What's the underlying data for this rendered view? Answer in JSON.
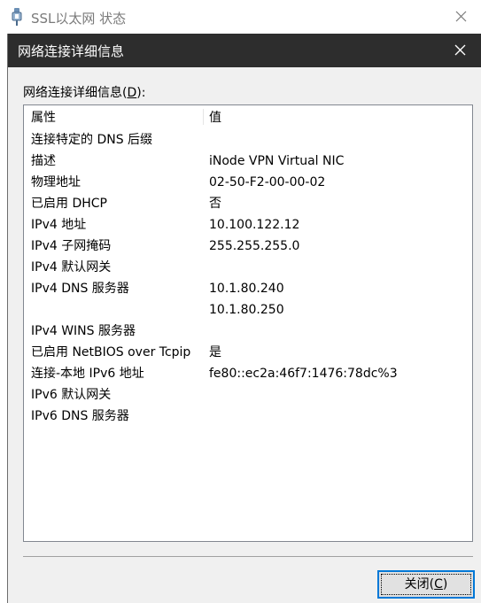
{
  "outer_window": {
    "title": "SSL以太网 状态",
    "app_icon": "network-connection-icon",
    "close_icon": "close-icon"
  },
  "dialog": {
    "title": "网络连接详细信息",
    "close_icon": "close-icon",
    "group_label": {
      "text": "网络连接详细信息(",
      "mnemonic": "D",
      "suffix": "):"
    },
    "columns": [
      "属性",
      "值"
    ],
    "rows": [
      {
        "prop": "连接特定的 DNS 后缀",
        "value": ""
      },
      {
        "prop": "描述",
        "value": "iNode VPN Virtual NIC"
      },
      {
        "prop": "物理地址",
        "value": "02-50-F2-00-00-02"
      },
      {
        "prop": "已启用 DHCP",
        "value": "否"
      },
      {
        "prop": "IPv4 地址",
        "value": "10.100.122.12"
      },
      {
        "prop": "IPv4 子网掩码",
        "value": "255.255.255.0"
      },
      {
        "prop": "IPv4 默认网关",
        "value": ""
      },
      {
        "prop": "IPv4 DNS 服务器",
        "value": "10.1.80.240"
      },
      {
        "prop": "",
        "value": "10.1.80.250"
      },
      {
        "prop": "IPv4 WINS 服务器",
        "value": ""
      },
      {
        "prop": "已启用 NetBIOS over Tcpip",
        "value": "是"
      },
      {
        "prop": "连接-本地 IPv6 地址",
        "value": "fe80::ec2a:46f7:1476:78dc%3"
      },
      {
        "prop": "IPv6 默认网关",
        "value": ""
      },
      {
        "prop": "IPv6 DNS 服务器",
        "value": ""
      }
    ],
    "close_button": {
      "text": "关闭(",
      "mnemonic": "C",
      "suffix": ")"
    }
  },
  "colors": {
    "dialog_titlebar": "#2d2d2d",
    "dialog_background": "#f0f0f0",
    "button_focus_border": "#0078d7",
    "outer_title_text": "#7a7a7a"
  }
}
